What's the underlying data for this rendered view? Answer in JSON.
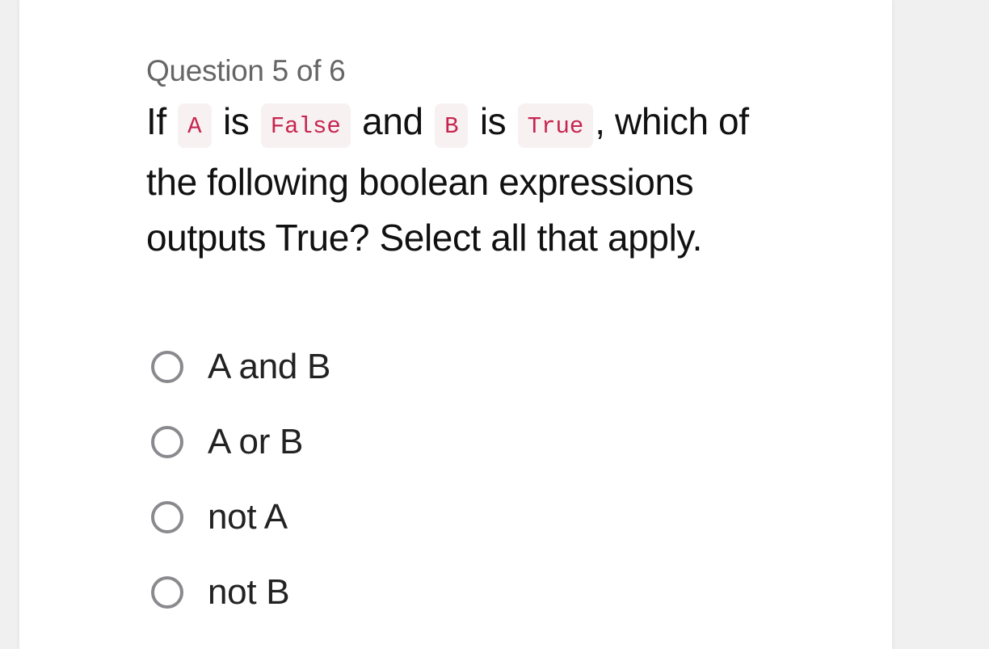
{
  "quiz": {
    "counter": "Question 5 of 6",
    "prompt": {
      "t1": "If ",
      "code_a": "A",
      "t2": " is ",
      "code_false": "False",
      "t3": " and ",
      "code_b": "B",
      "t4": " is ",
      "code_true": "True",
      "t5": ", which of the following boolean expressions outputs True? Select all that apply."
    },
    "options": [
      {
        "label": "A and B",
        "selected": false
      },
      {
        "label": "A or B",
        "selected": false
      },
      {
        "label": "not A",
        "selected": false
      },
      {
        "label": "not B",
        "selected": false
      }
    ]
  },
  "colors": {
    "code_text": "#c7254e",
    "code_bg": "#f7f1f2",
    "radio_border": "#8a8a8e"
  }
}
